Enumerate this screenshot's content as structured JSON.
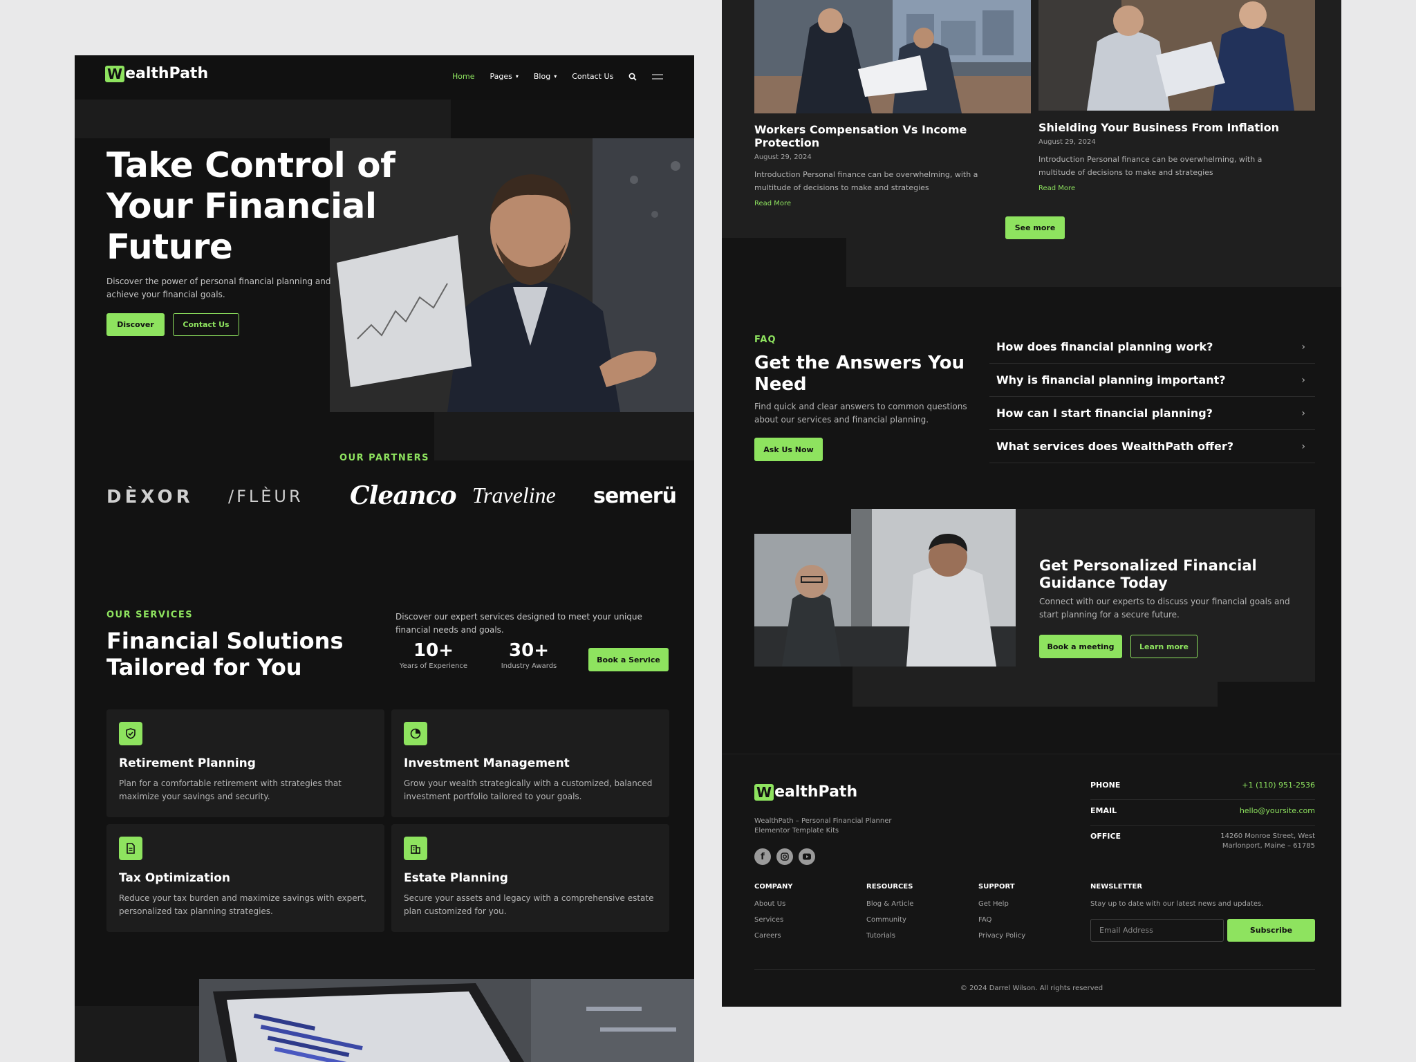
{
  "brand": {
    "name": "WealthPath",
    "logo_prefix": "W",
    "logo_rest": "ealthPath",
    "accent": "#8ee35f"
  },
  "nav": {
    "home": "Home",
    "pages": "Pages",
    "blog": "Blog",
    "contact": "Contact Us"
  },
  "hero": {
    "title_l1": "Take Control of",
    "title_l2": "Your Financial",
    "title_l3": "Future",
    "sub_l1": "Discover the power of personal financial planning and",
    "sub_l2": "achieve your financial goals.",
    "discover": "Discover",
    "contact": "Contact Us"
  },
  "partners": {
    "label": "OUR PARTNERS",
    "logos": [
      "DÈXOR",
      "/FLÈUR",
      "Cleanco",
      "Traveline",
      "semerü"
    ]
  },
  "services": {
    "label": "OUR SERVICES",
    "title_l1": "Financial Solutions",
    "title_l2": "Tailored for You",
    "desc_l1": "Discover our expert services designed to meet your unique",
    "desc_l2": "financial needs and goals.",
    "stat1_value": "10+",
    "stat1_label": "Years of Experience",
    "stat2_value": "30+",
    "stat2_label": "Industry Awards",
    "book": "Book a Service",
    "cards": [
      {
        "icon": "shield-check-icon",
        "title": "Retirement Planning",
        "d1": "Plan for a comfortable retirement with strategies that",
        "d2": "maximize your savings and security."
      },
      {
        "icon": "pie-chart-icon",
        "title": "Investment Management",
        "d1": "Grow your wealth strategically with a customized, balanced",
        "d2": "investment portfolio tailored to your goals."
      },
      {
        "icon": "document-icon",
        "title": "Tax Optimization",
        "d1": "Reduce your tax burden and maximize savings with expert,",
        "d2": "personalized tax planning strategies."
      },
      {
        "icon": "building-icon",
        "title": "Estate Planning",
        "d1": "Secure your assets and legacy with a comprehensive estate",
        "d2": "plan customized for you."
      }
    ]
  },
  "blog": {
    "posts": [
      {
        "title": "Workers Compensation Vs Income Protection",
        "date": "August 29, 2024",
        "d1": "Introduction Personal finance can be overwhelming, with a",
        "d2": "multitude of decisions to make and strategies",
        "read": "Read More"
      },
      {
        "title": "Shielding Your Business From Inflation",
        "date": "August 29, 2024",
        "d1": "Introduction Personal finance can be overwhelming, with a",
        "d2": "multitude of decisions to make and strategies",
        "read": "Read More"
      }
    ],
    "see_more": "See more"
  },
  "faq": {
    "label": "FAQ",
    "title_l1": "Get the Answers You",
    "title_l2": "Need",
    "desc_l1": "Find quick and clear answers to common questions",
    "desc_l2": "about our services and financial planning.",
    "ask": "Ask Us Now",
    "items": [
      "How does financial planning work?",
      "Why is financial planning important?",
      "How can I start financial planning?",
      "What services does WealthPath offer?"
    ]
  },
  "cta": {
    "title_l1": "Get Personalized Financial",
    "title_l2": "Guidance Today",
    "desc_l1": "Connect with our experts to discuss your financial goals and",
    "desc_l2": "start planning for a secure future.",
    "book": "Book a meeting",
    "learn": "Learn more"
  },
  "footer": {
    "tag_l1": "WealthPath – Personal Financial Planner",
    "tag_l2": "Elementor Template Kits",
    "phone_label": "PHONE",
    "phone": "+1 (110) 951-2536",
    "email_label": "EMAIL",
    "email": "hello@yoursite.com",
    "office_label": "OFFICE",
    "office_l1": "14260 Monroe Street, West",
    "office_l2": "Marlonport, Maine – 61785",
    "company": "COMPANY",
    "company_items": [
      "About Us",
      "Services",
      "Careers"
    ],
    "resources": "RESOURCES",
    "resources_items": [
      "Blog & Article",
      "Community",
      "Tutorials"
    ],
    "support": "SUPPORT",
    "support_items": [
      "Get Help",
      "FAQ",
      "Privacy Policy"
    ],
    "newsletter": "NEWSLETTER",
    "newsletter_desc": "Stay up to date with our latest news and updates.",
    "email_placeholder": "Email Address",
    "subscribe": "Subscribe",
    "copyright": "© 2024 Darrel Wilson. All rights reserved"
  }
}
